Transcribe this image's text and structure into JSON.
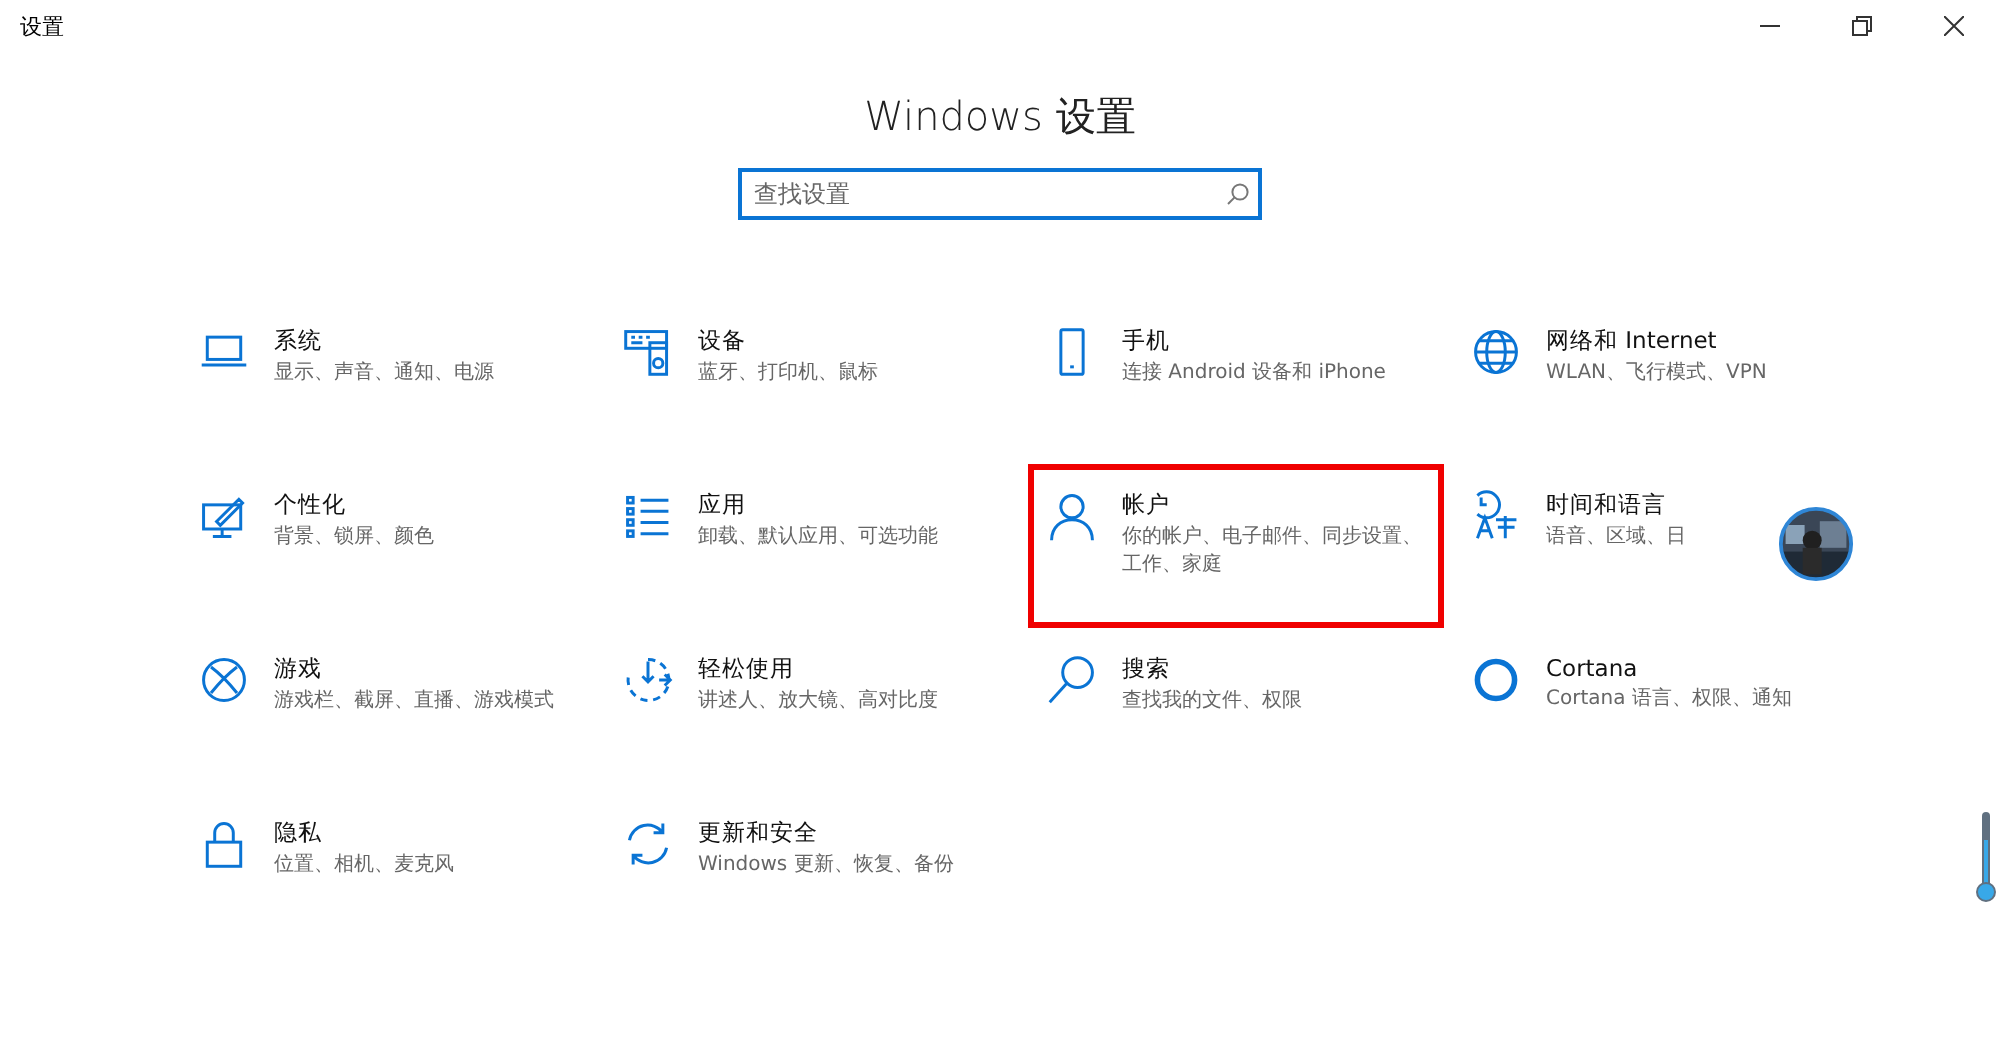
{
  "window": {
    "title": "设置"
  },
  "heading": "Windows 设置",
  "search": {
    "placeholder": "查找设置"
  },
  "tiles": [
    {
      "kind": "laptop",
      "title": "系统",
      "subtitle": "显示、声音、通知、电源",
      "highlighted": false
    },
    {
      "kind": "keyboard",
      "title": "设备",
      "subtitle": "蓝牙、打印机、鼠标",
      "highlighted": false
    },
    {
      "kind": "phone",
      "title": "手机",
      "subtitle": "连接 Android 设备和 iPhone",
      "highlighted": false
    },
    {
      "kind": "globe",
      "title": "网络和 Internet",
      "subtitle": "WLAN、飞行模式、VPN",
      "highlighted": false
    },
    {
      "kind": "paint",
      "title": "个性化",
      "subtitle": "背景、锁屏、颜色",
      "highlighted": false
    },
    {
      "kind": "apps",
      "title": "应用",
      "subtitle": "卸载、默认应用、可选功能",
      "highlighted": false
    },
    {
      "kind": "person",
      "title": "帐户",
      "subtitle": "你的帐户、电子邮件、同步设置、工作、家庭",
      "highlighted": true
    },
    {
      "kind": "language",
      "title": "时间和语言",
      "subtitle": "语音、区域、日",
      "highlighted": false
    },
    {
      "kind": "xbox",
      "title": "游戏",
      "subtitle": "游戏栏、截屏、直播、游戏模式",
      "highlighted": false
    },
    {
      "kind": "ease",
      "title": "轻松使用",
      "subtitle": "讲述人、放大镜、高对比度",
      "highlighted": false
    },
    {
      "kind": "search",
      "title": "搜索",
      "subtitle": "查找我的文件、权限",
      "highlighted": false
    },
    {
      "kind": "cortana",
      "title": "Cortana",
      "subtitle": "Cortana 语言、权限、通知",
      "highlighted": false
    },
    {
      "kind": "lock",
      "title": "隐私",
      "subtitle": "位置、相机、麦克风",
      "highlighted": false
    },
    {
      "kind": "update",
      "title": "更新和安全",
      "subtitle": "Windows 更新、恢复、备份",
      "highlighted": false
    }
  ]
}
